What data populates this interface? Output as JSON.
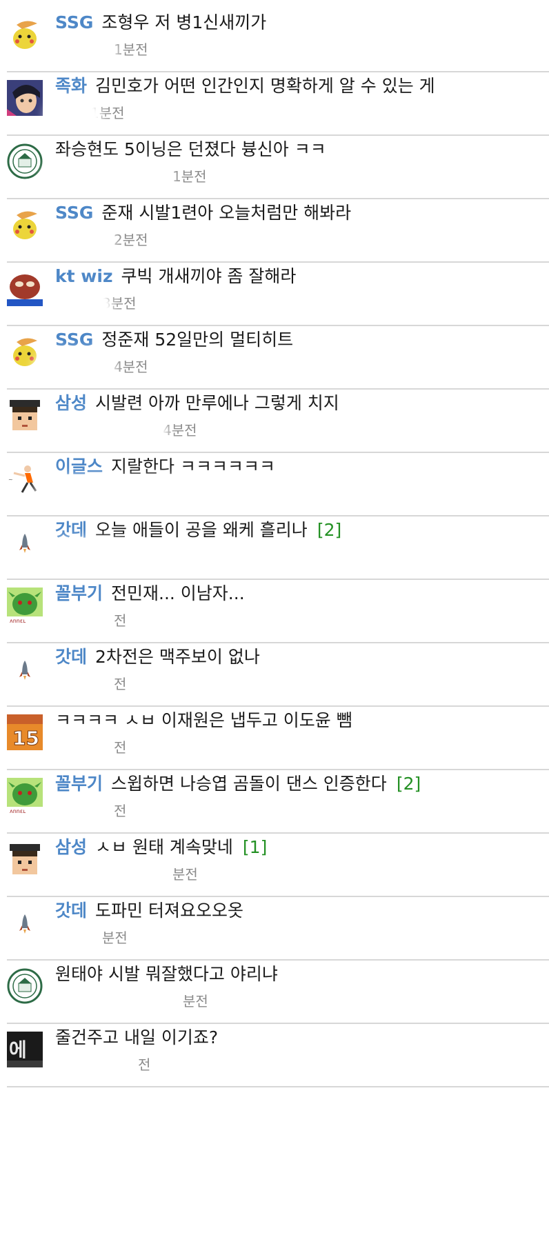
{
  "posts": [
    {
      "team": "SSG",
      "title": "조형우 저 병1신새끼가",
      "time": "1분전",
      "avatar": "pikachu-icon",
      "comments": ""
    },
    {
      "team": "족화",
      "title": "김민호가 어떤 인간인지 명확하게 알 수 있는 게",
      "time": "1분전",
      "avatar": "anime-face-icon",
      "comments": ""
    },
    {
      "team": "",
      "title": "좌승현도 5이닝은 던졌다 븅신아 ㅋㅋ",
      "time": "1분전",
      "avatar": "university-seal-icon",
      "comments": ""
    },
    {
      "team": "SSG",
      "title": "준재 시발1련아 오늘처럼만 해봐라",
      "time": "2분전",
      "avatar": "pikachu-icon",
      "comments": ""
    },
    {
      "team": "kt wiz",
      "title": "쿠빅 개새끼야 좀 잘해라",
      "time": "3분전",
      "avatar": "pepe-frog-icon",
      "comments": ""
    },
    {
      "team": "SSG",
      "title": "정준재 52일만의 멀티히트",
      "time": "4분전",
      "avatar": "pikachu-icon",
      "comments": ""
    },
    {
      "team": "삼성",
      "title": "시발련 아까 만루에나 그렇게 치지",
      "time": "4분전",
      "avatar": "pixel-graduate-icon",
      "comments": ""
    },
    {
      "team": "이글스",
      "title": "지랄한다 ㅋㅋㅋㅋㅋㅋ",
      "time": "",
      "avatar": "baseball-pitcher-icon",
      "comments": ""
    },
    {
      "team": "갓데",
      "title": "오늘 애들이 공을 왜케 흘리나",
      "time": "",
      "avatar": "rocket-icon",
      "comments": "[2]"
    },
    {
      "team": "꼴부기",
      "title": "전민재... 이남자...",
      "time": "전",
      "avatar": "green-goblin-icon",
      "comments": ""
    },
    {
      "team": "갓데",
      "title": "2차전은 맥주보이 없나",
      "time": "전",
      "avatar": "rocket-icon",
      "comments": ""
    },
    {
      "team": "",
      "title": "ㅋㅋㅋㅋ ㅅㅂ 이재원은 냅두고 이도윤 뺌",
      "time": "전",
      "avatar": "jersey-15-icon",
      "comments": ""
    },
    {
      "team": "꼴부기",
      "title": "스윕하면 나승엽 곰돌이 댄스 인증한다",
      "time": "전",
      "avatar": "green-goblin-icon",
      "comments": "[2]"
    },
    {
      "team": "삼성",
      "title": "ㅅㅂ 원태 계속맞네",
      "time": "분전",
      "avatar": "pixel-graduate-icon",
      "comments": "[1]"
    },
    {
      "team": "갓데",
      "title": "도파민 터져요오오옷",
      "time": "분전",
      "avatar": "rocket-icon",
      "comments": ""
    },
    {
      "team": "",
      "title": "원태야 시발 뭐잘했다고 야리냐",
      "time": "분전",
      "avatar": "university-seal-icon",
      "comments": ""
    },
    {
      "team": "",
      "title": "줄건주고 내일 이기죠?",
      "time": "전",
      "avatar": "pixel-text-icon",
      "comments": ""
    }
  ],
  "colors": {
    "team": "#4d87c7",
    "comments": "#239023",
    "meta": "#8a8a8a",
    "divider": "#d7d7d7"
  }
}
